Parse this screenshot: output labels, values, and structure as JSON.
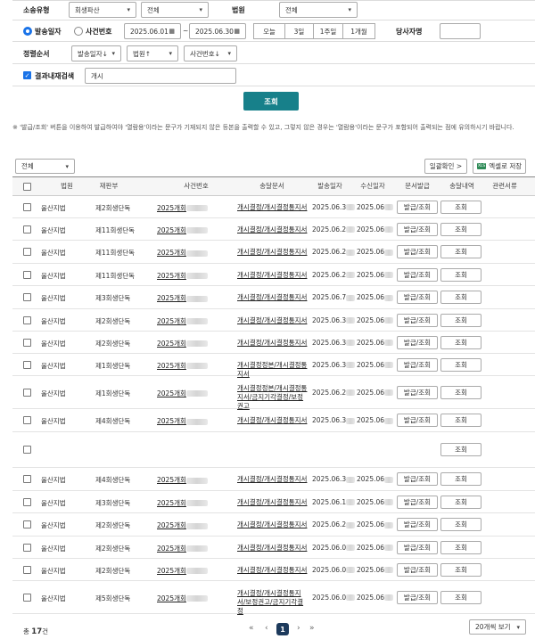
{
  "filters": {
    "litigation_type_label": "소송유형",
    "litigation_type_value": "회생파산",
    "litigation_sub_value": "전체",
    "court_label": "법원",
    "court_value": "전체",
    "date_basis_send": "발송일자",
    "date_basis_case": "사건번호",
    "date_from": "2025.06.01",
    "date_to": "2025.06.30",
    "date_sep": "~",
    "quick_ranges": [
      "오늘",
      "3일",
      "1주일",
      "1개월"
    ],
    "party_label": "당사자명",
    "party_value": "",
    "sort_label": "정렬순서",
    "sort_options": [
      "발송일자↓",
      "법원↑",
      "사건번호↓"
    ],
    "refine_label": "결과내재검색",
    "refine_value": "개시",
    "search_button": "조회"
  },
  "notice": "※ '발급/조회' 버튼을 이용하여 발급하여야 '열람용'이라는 문구가 기재되지 않은 등본을 출력할 수 있고, 그렇지 않은 경우는 '열람용'이라는 문구가 포함되어 출력되는 점에 유의하시기 바랍니다.",
  "list_controls": {
    "filter_value": "전체",
    "bulk_check_label": "일괄확인 >",
    "excel_label": "엑셀로 저장",
    "excel_icon_text": "XLS"
  },
  "table": {
    "headers": [
      "법원",
      "재판부",
      "사건번호",
      "송달문서",
      "발송일자",
      "수신일자",
      "문서발급",
      "송달내역",
      "관련서류"
    ],
    "issue_label": "발급/조회",
    "view_label": "조회",
    "rows": [
      {
        "court": "울산지법",
        "division": "제2회생단독",
        "case": "2025개회",
        "doc": "개시결정/개시결정통지서",
        "sent": "2025.06.3",
        "recv": "2025.06"
      },
      {
        "court": "울산지법",
        "division": "제11회생단독",
        "case": "2025개회",
        "doc": "개시결정/개시결정통지서",
        "sent": "2025.06.2",
        "recv": "2025.06"
      },
      {
        "court": "울산지법",
        "division": "제11회생단독",
        "case": "2025개회",
        "doc": "개시결정/개시결정통지서",
        "sent": "2025.06.2",
        "recv": "2025.06"
      },
      {
        "court": "울산지법",
        "division": "제11회생단독",
        "case": "2025개회",
        "doc": "개시결정/개시결정통지서",
        "sent": "2025.06.2",
        "recv": "2025.06"
      },
      {
        "court": "울산지법",
        "division": "제3회생단독",
        "case": "2025개회",
        "doc": "개시결정/개시결정통지서",
        "sent": "2025.06.7",
        "recv": "2025.06"
      },
      {
        "court": "울산지법",
        "division": "제2회생단독",
        "case": "2025개회",
        "doc": "개시결정/개시결정통지서",
        "sent": "2025.06.3",
        "recv": "2025.06"
      },
      {
        "court": "울산지법",
        "division": "제2회생단독",
        "case": "2025개회",
        "doc": "개시결정/개시결정통지서",
        "sent": "2025.06.3",
        "recv": "2025.06"
      },
      {
        "court": "울산지법",
        "division": "제1회생단독",
        "case": "2025개회",
        "doc": "개시결정정본/개시결정통지서",
        "sent": "2025.06.3",
        "recv": "2025.06"
      },
      {
        "court": "울산지법",
        "division": "제1회생단독",
        "case": "2025개회",
        "doc": "개시결정정본/개시결정통지서/금지기각결정/보정권고",
        "sent": "2025.06.2",
        "recv": "2025.06"
      },
      {
        "court": "울산지법",
        "division": "제4회생단독",
        "case": "2025개회",
        "doc": "개시결정/개시결정통지서",
        "sent": "2025.06.3",
        "recv": "2025.06"
      },
      {
        "court": "",
        "division": "",
        "case": "",
        "doc": "",
        "sent": "",
        "recv": ""
      },
      {
        "court": "울산지법",
        "division": "제4회생단독",
        "case": "2025개회",
        "doc": "개시결정/개시결정통지서",
        "sent": "2025.06.3",
        "recv": "2025.06"
      },
      {
        "court": "울산지법",
        "division": "제3회생단독",
        "case": "2025개회",
        "doc": "개시결정/개시결정통지서",
        "sent": "2025.06.1",
        "recv": "2025.06"
      },
      {
        "court": "울산지법",
        "division": "제2회생단독",
        "case": "2025개회",
        "doc": "개시결정/개시결정통지서",
        "sent": "2025.06.2",
        "recv": "2025.06"
      },
      {
        "court": "울산지법",
        "division": "제2회생단독",
        "case": "2025개회",
        "doc": "개시결정/개시결정통지서",
        "sent": "2025.06.0",
        "recv": "2025.06"
      },
      {
        "court": "울산지법",
        "division": "제2회생단독",
        "case": "2025개회",
        "doc": "개시결정/개시결정통지서",
        "sent": "2025.06.0",
        "recv": "2025.06"
      },
      {
        "court": "울산지법",
        "division": "제5회생단독",
        "case": "2025개회",
        "doc": "개시결정/개시결정통지서/보정권고/금지기각결정",
        "sent": "2025.06.0",
        "recv": "2025.06"
      }
    ]
  },
  "footer": {
    "total_prefix": "총",
    "total_count": "17",
    "total_suffix": "건",
    "current_page": "1",
    "page_size": "20개씩 보기"
  }
}
